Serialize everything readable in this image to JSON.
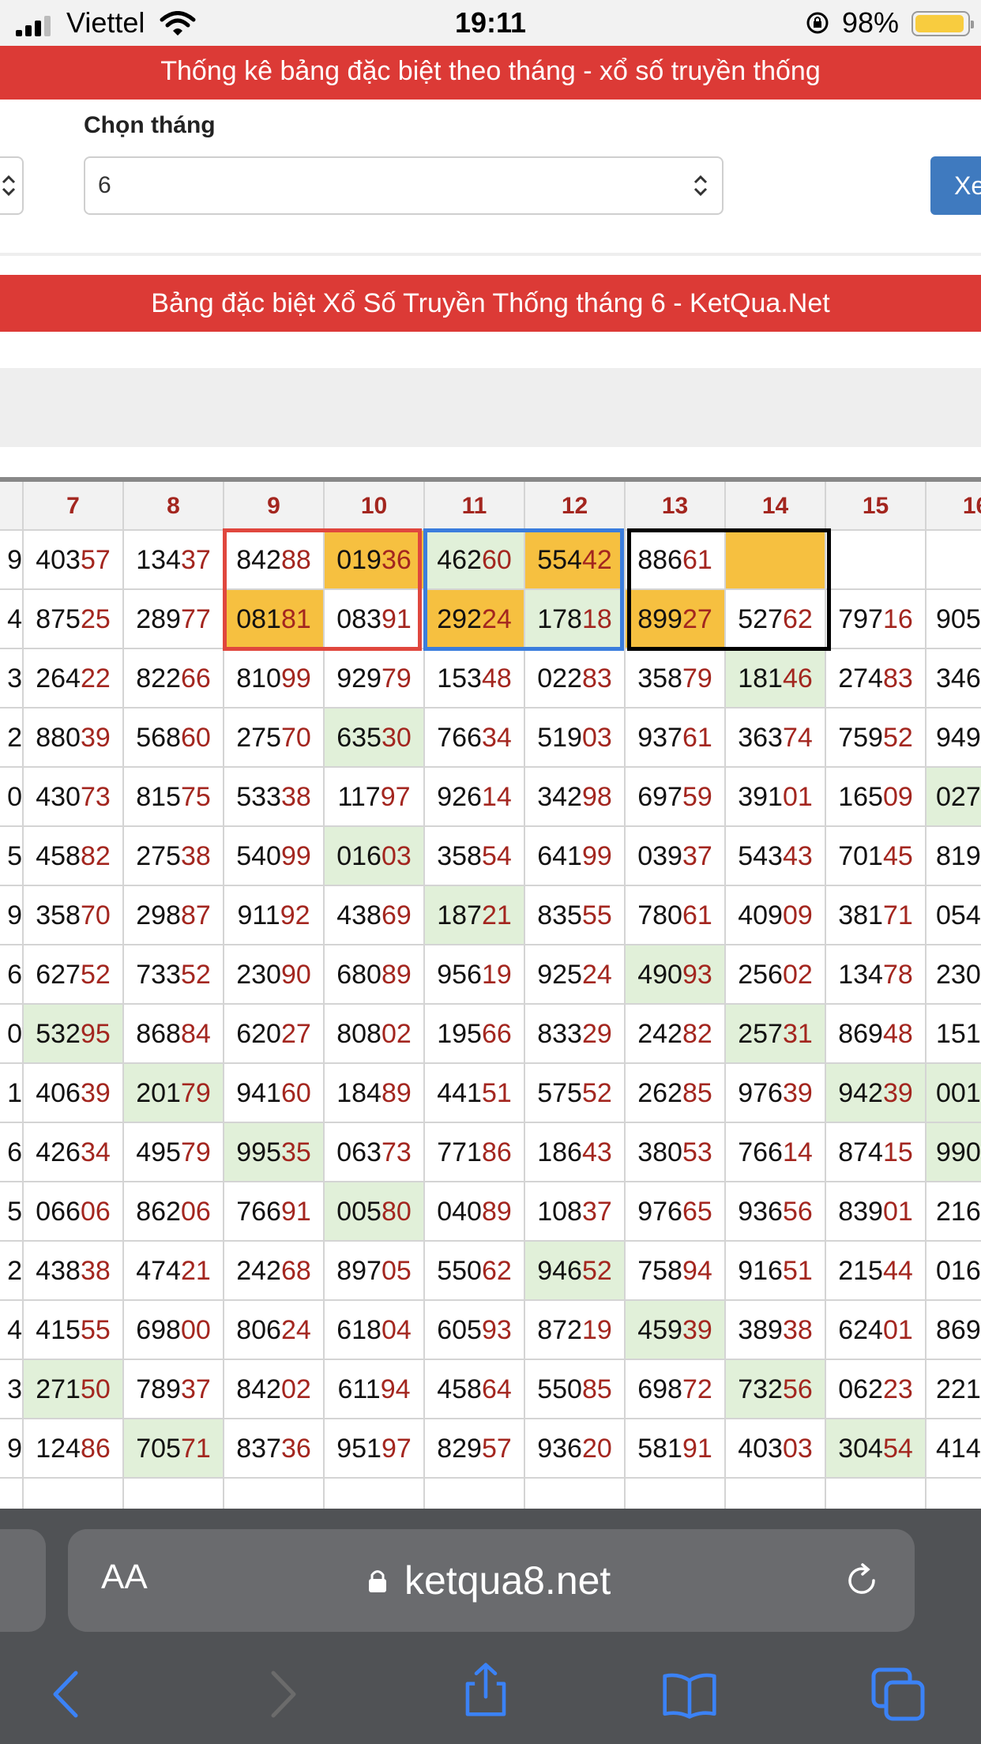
{
  "status_bar": {
    "carrier": "Viettel",
    "time": "19:11",
    "battery": "98%"
  },
  "banner_title": "Thống kê bảng đặc biệt theo tháng - xổ số truyền thống",
  "month_select": {
    "label": "Chọn tháng",
    "value": "6",
    "button_label": "Xe"
  },
  "table_title": "Bảng đặc biệt Xổ Số Truyền Thống tháng 6 - KetQua.Net",
  "table": {
    "columns": [
      {
        "header": "",
        "cells": [
          "9",
          "4",
          "3",
          "2",
          "0",
          "5",
          "9",
          "6",
          "0",
          "1",
          "6",
          "5",
          "2",
          "4",
          "3",
          "9",
          ""
        ]
      },
      {
        "header": "7",
        "cells": [
          "40357",
          "87525",
          "26422",
          "88039",
          "43073",
          "45882",
          "35870",
          "62752",
          "53295",
          "40639",
          "42634",
          "06606",
          "43838",
          "41555",
          "27150",
          "12486",
          ""
        ]
      },
      {
        "header": "8",
        "cells": [
          "13437",
          "28977",
          "82266",
          "56860",
          "81575",
          "27538",
          "29887",
          "73352",
          "86884",
          "20179",
          "49579",
          "86206",
          "47421",
          "69800",
          "78937",
          "70571",
          ""
        ]
      },
      {
        "header": "9",
        "cells": [
          "84288",
          "08181",
          "81099",
          "27570",
          "53338",
          "54099",
          "91192",
          "23090",
          "62027",
          "94160",
          "99535",
          "76691",
          "24268",
          "80624",
          "84202",
          "83736",
          ""
        ]
      },
      {
        "header": "10",
        "cells": [
          "01936",
          "08391",
          "92979",
          "63530",
          "11797",
          "01603",
          "43869",
          "68089",
          "80802",
          "18489",
          "06373",
          "00580",
          "89705",
          "61804",
          "61194",
          "95197",
          ""
        ]
      },
      {
        "header": "11",
        "cells": [
          "46260",
          "29224",
          "15348",
          "76634",
          "92614",
          "35854",
          "18721",
          "95619",
          "19566",
          "44151",
          "77186",
          "04089",
          "55062",
          "60593",
          "45864",
          "82957",
          ""
        ]
      },
      {
        "header": "12",
        "cells": [
          "55442",
          "17818",
          "02283",
          "51903",
          "34298",
          "64199",
          "83555",
          "92524",
          "83329",
          "57552",
          "18643",
          "10837",
          "94652",
          "87219",
          "55085",
          "93620",
          ""
        ]
      },
      {
        "header": "13",
        "cells": [
          "88661",
          "89927",
          "35879",
          "93761",
          "69759",
          "03937",
          "78061",
          "49093",
          "24282",
          "26285",
          "38053",
          "97665",
          "75894",
          "45939",
          "69872",
          "58191",
          ""
        ]
      },
      {
        "header": "14",
        "cells": [
          "",
          "52762",
          "18146",
          "36374",
          "39101",
          "54343",
          "40909",
          "25602",
          "25731",
          "97639",
          "76614",
          "93656",
          "91651",
          "38938",
          "73256",
          "40303",
          ""
        ]
      },
      {
        "header": "15",
        "cells": [
          "",
          "79716",
          "27483",
          "75952",
          "16509",
          "70145",
          "38171",
          "13478",
          "86948",
          "94239",
          "87415",
          "83901",
          "21544",
          "62401",
          "06223",
          "30454",
          ""
        ]
      },
      {
        "header": "16",
        "cells": [
          "",
          "905",
          "346",
          "949",
          "027",
          "819",
          "054",
          "230",
          "151",
          "001",
          "990",
          "216",
          "016",
          "869",
          "221",
          "414",
          ""
        ]
      }
    ]
  },
  "url_bar": {
    "aa_label": "AA",
    "url": "ketqua8.net"
  },
  "colors": {
    "red": "#dc3a36",
    "tail_red": "#a3261f",
    "green": "#e1f0d9",
    "yellow": "#f6c040",
    "blue_button": "#3f7abf"
  },
  "icons": [
    "signal-icon",
    "wifi-icon",
    "rotation-lock-icon",
    "battery-icon",
    "lock-icon",
    "reload-icon",
    "back-icon",
    "forward-icon",
    "share-icon",
    "bookmarks-icon",
    "tabs-icon"
  ]
}
